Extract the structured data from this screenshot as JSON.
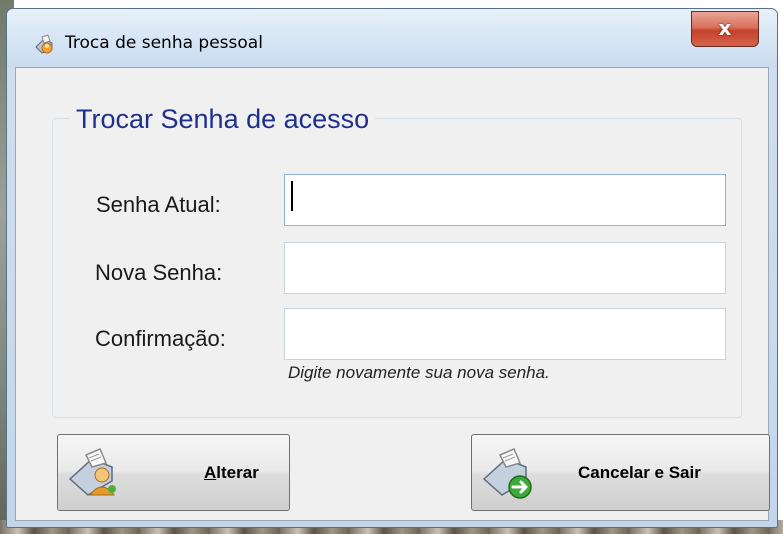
{
  "window": {
    "title": "Troca de senha pessoal",
    "close_label": "x"
  },
  "group": {
    "title": "Trocar Senha de acesso"
  },
  "fields": {
    "current_password": {
      "label": "Senha Atual:",
      "value": ""
    },
    "new_password": {
      "label": "Nova Senha:",
      "value": ""
    },
    "confirmation": {
      "label": "Confirmação:",
      "value": ""
    }
  },
  "hint": "Digite novamente sua nova senha.",
  "buttons": {
    "alter": {
      "accel": "A",
      "rest": "lterar"
    },
    "cancel": {
      "label": "Cancelar e Sair"
    }
  },
  "icons": {
    "app": "app-icon",
    "alter": "alter-user-icon",
    "cancel": "exit-icon",
    "close": "close-icon"
  },
  "colors": {
    "group_title": "#1f2f8f",
    "close_button": "#c4412a",
    "titlebar": "#d7e6f5"
  }
}
